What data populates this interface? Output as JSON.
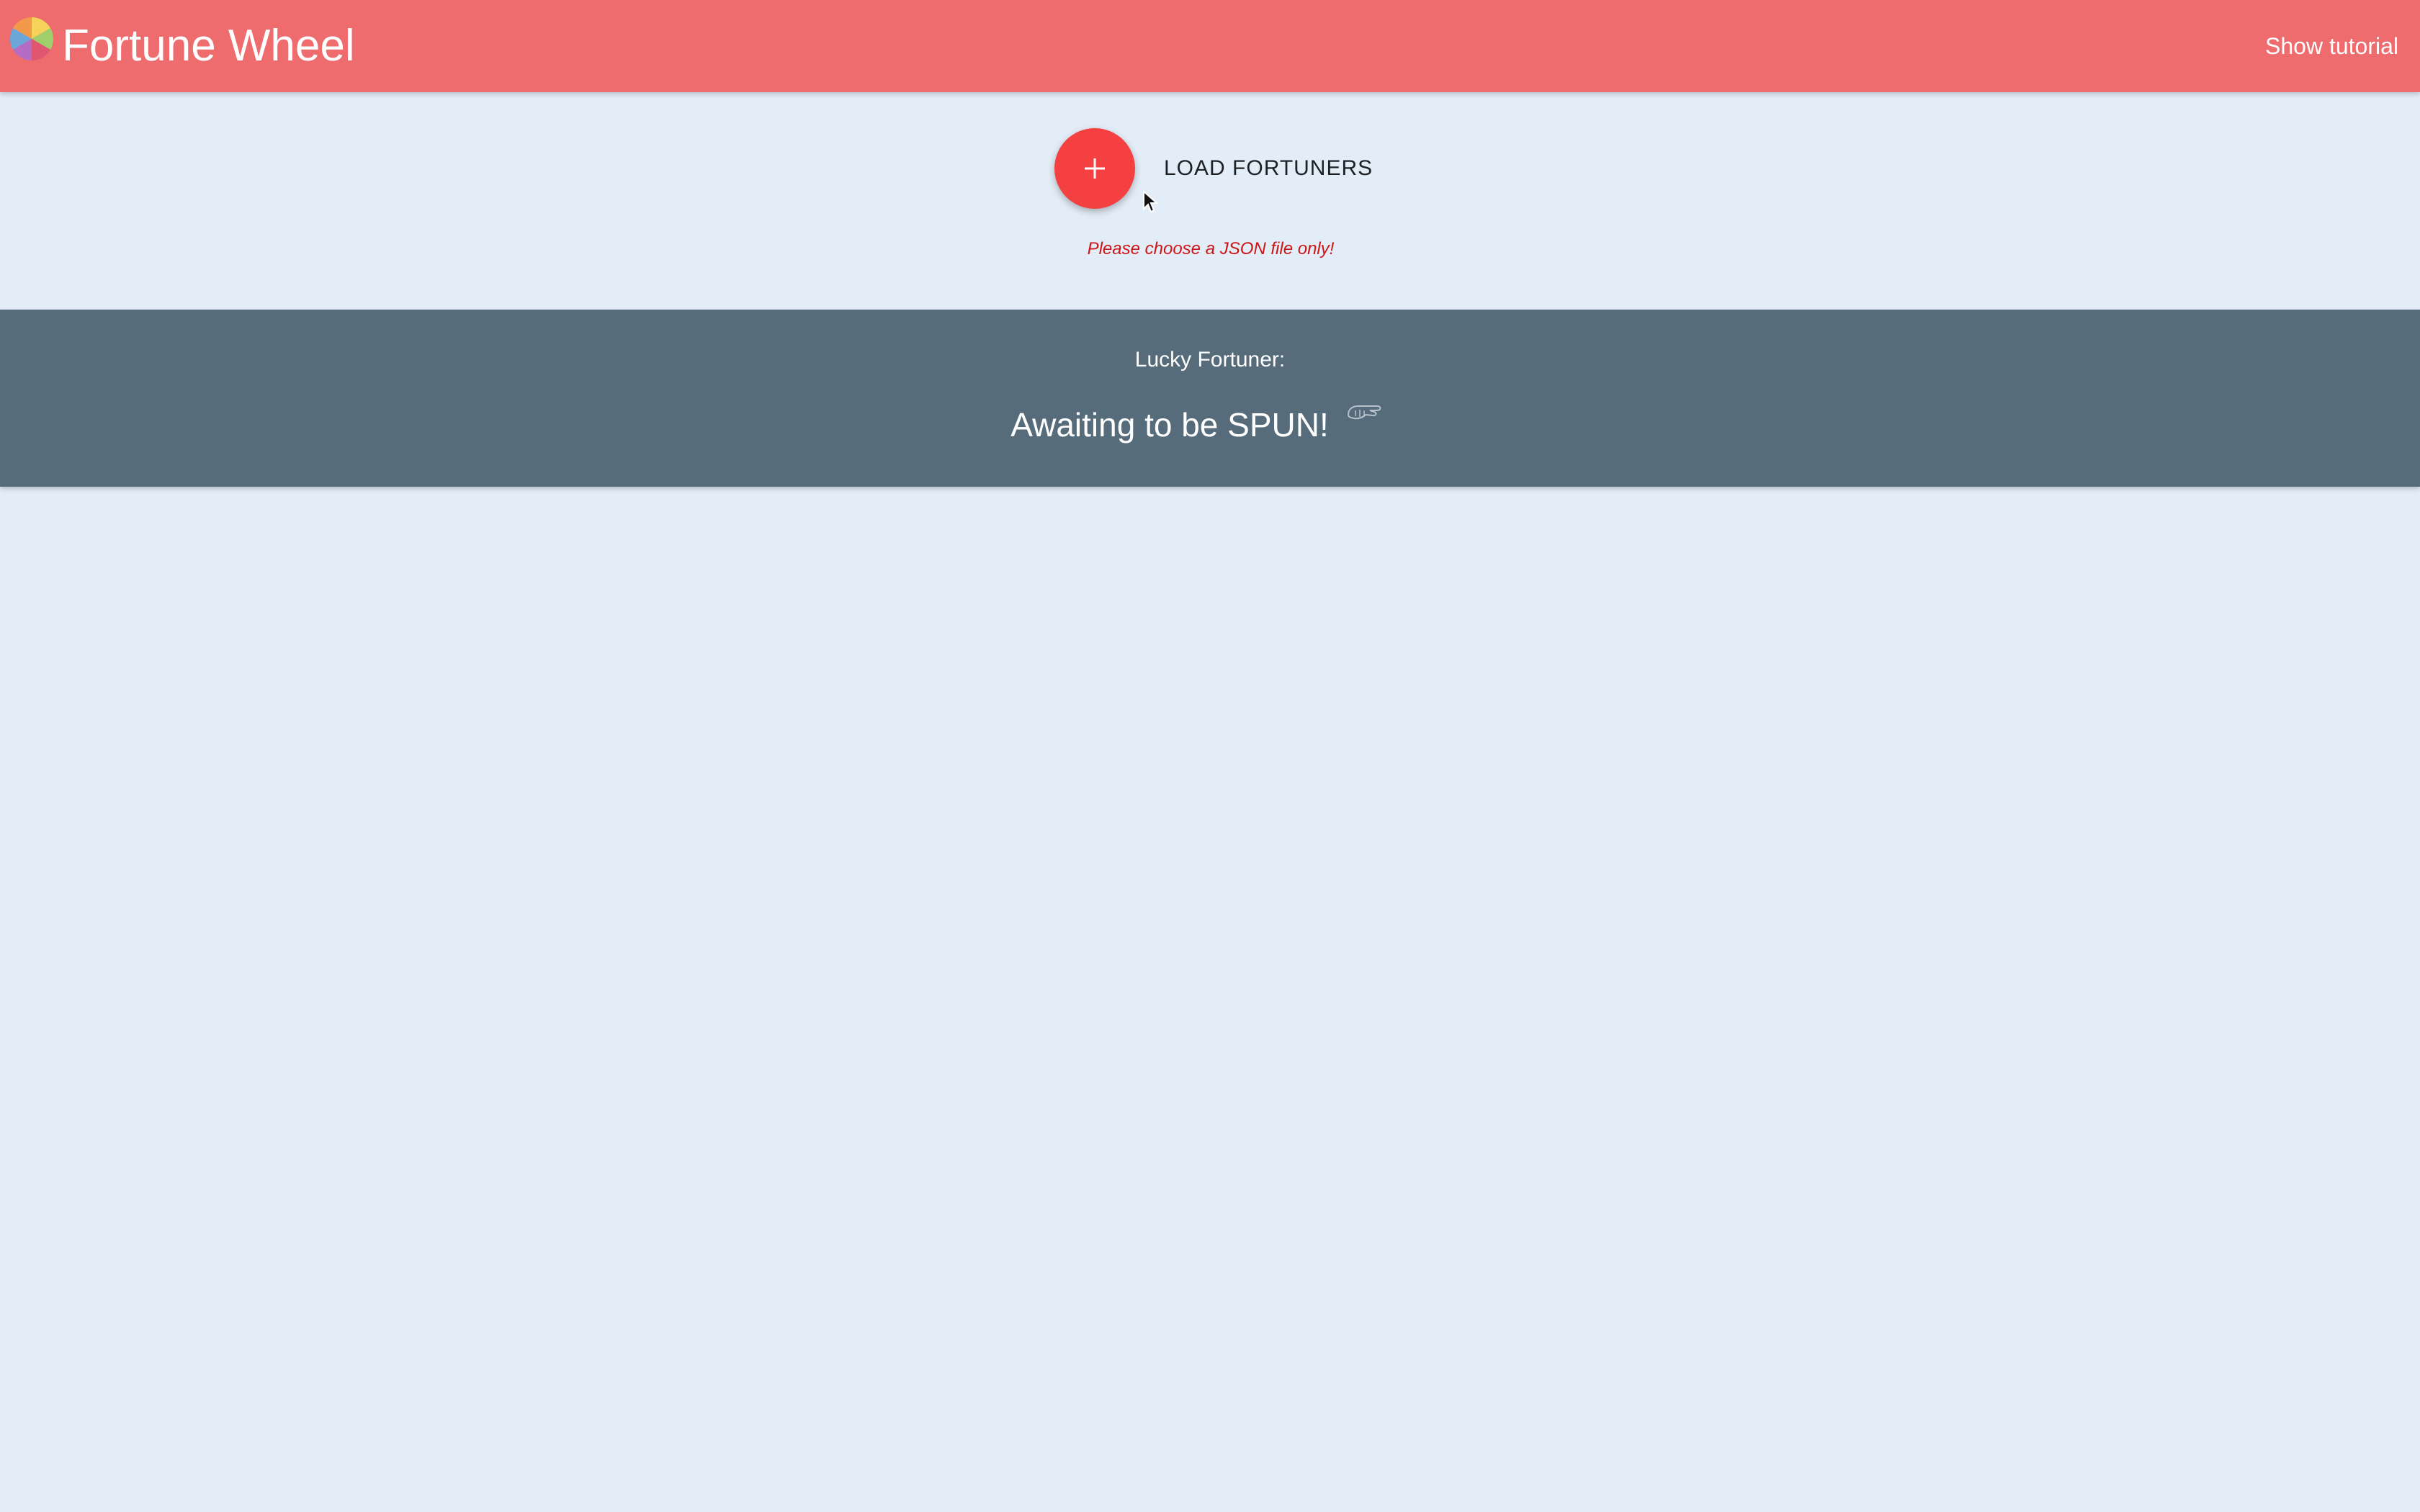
{
  "header": {
    "title": "Fortune Wheel",
    "tutorial_link": "Show tutorial",
    "logo_icon": "fortune-wheel-logo"
  },
  "loader": {
    "button_icon": "plus-icon",
    "label": "LOAD FORTUNERS",
    "error": "Please choose a JSON file only!"
  },
  "result": {
    "label": "Lucky Fortuner:",
    "value": "Awaiting to be SPUN!",
    "icon": "pointing-hand-icon"
  },
  "colors": {
    "header": "#ee6b6e",
    "background": "#e3edf7",
    "fab": "#f44040",
    "result_panel": "#566c7b",
    "error": "#cc1515"
  }
}
